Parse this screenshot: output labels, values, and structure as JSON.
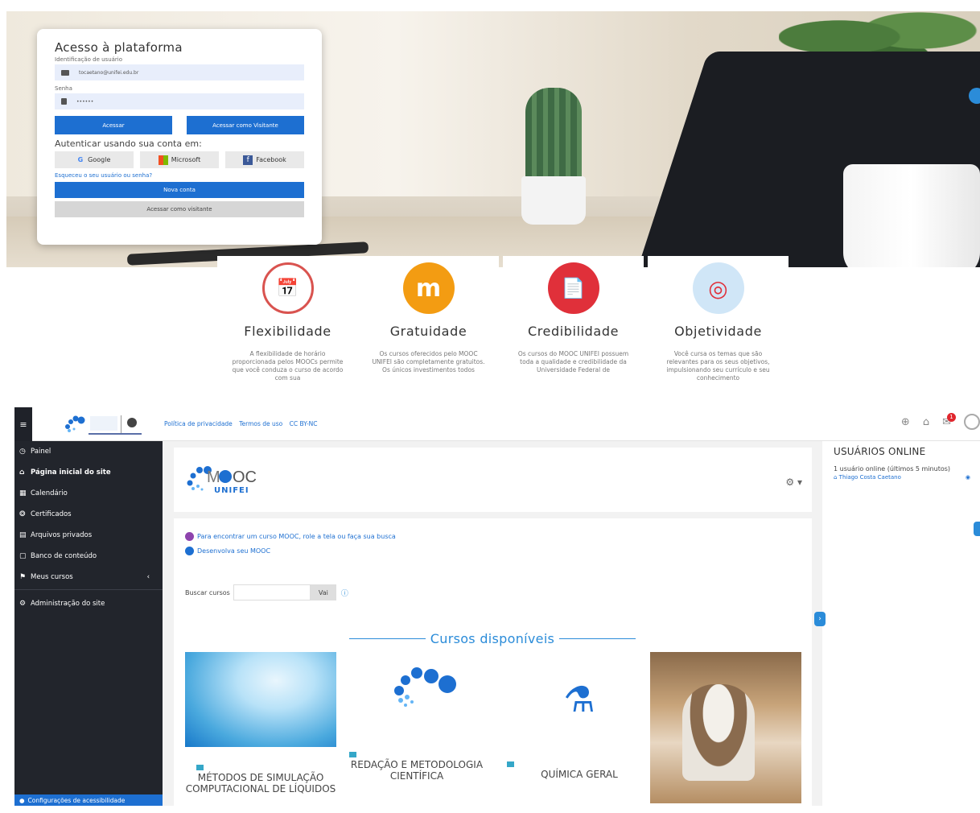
{
  "login": {
    "title": "Acesso à plataforma",
    "user_label": "Identificação de usuário",
    "user_value": "tocaetano@unifei.edu.br",
    "pass_label": "Senha",
    "pass_value": "••••••",
    "login_button": "Acessar",
    "visitor_button": "Acessar como Visitante",
    "auth_label": "Autenticar usando sua conta em:",
    "google": "Google",
    "microsoft": "Microsoft",
    "facebook": "Facebook",
    "forgot": "Esqueceu o seu usuário ou senha?",
    "new_account": "Nova conta",
    "visitor_button2": "Acessar como visitante"
  },
  "features": [
    {
      "title": "Flexibilidade",
      "icon": "calendar-clock-icon",
      "color": "#d9534f",
      "desc": "A flexibilidade de horário proporcionada pelos MOOCs permite que você conduza o curso de acordo com sua"
    },
    {
      "title": "Gratuidade",
      "icon": "moodle-icon",
      "color": "#f39c12",
      "desc": "Os cursos oferecidos pelo MOOC UNIFEI são completamente gratuitos. Os únicos investimentos todos"
    },
    {
      "title": "Credibilidade",
      "icon": "certificate-icon",
      "color": "#e0303a",
      "desc": "Os cursos do MOOC UNIFEI possuem toda a qualidade e credibilidade da Universidade Federal de"
    },
    {
      "title": "Objetividade",
      "icon": "target-icon",
      "color": "#d0e6f7",
      "desc": "Você cursa os temas que são relevantes para os seus objetivos, impulsionando seu currículo e seu conhecimento"
    }
  ],
  "navbar": {
    "links": [
      "Política de privacidade",
      "Termos de uso",
      "CC BY-NC"
    ],
    "notifications_count": "1"
  },
  "sidebar": {
    "items": [
      {
        "label": "Painel",
        "icon": "dashboard-icon"
      },
      {
        "label": "Página inicial do site",
        "icon": "home-icon"
      },
      {
        "label": "Calendário",
        "icon": "calendar-icon"
      },
      {
        "label": "Certificados",
        "icon": "certificate-icon"
      },
      {
        "label": "Arquivos privados",
        "icon": "file-icon"
      },
      {
        "label": "Banco de conteúdo",
        "icon": "folder-icon"
      },
      {
        "label": "Meus cursos",
        "icon": "graduation-cap-icon"
      },
      {
        "label": "Administração do site",
        "icon": "gear-icon"
      }
    ],
    "accessibility": "Configurações de acessibilidade"
  },
  "main": {
    "brand_main": "M",
    "brand_oc": "OC",
    "brand_sub": "UNIFEI",
    "note1": "Para encontrar um curso MOOC, role a tela ou faça sua busca",
    "note2": "Desenvolva seu MOOC",
    "search_label": "Buscar cursos",
    "search_button": "Vai",
    "courses_heading": "Cursos disponíveis",
    "courses": [
      {
        "name": "MÉTODOS DE SIMULAÇÃO COMPUTACIONAL DE LÍQUIDOS"
      },
      {
        "name": "REDAÇÃO E METODOLOGIA CIENTÍFICA"
      },
      {
        "name": "QUÍMICA GERAL"
      },
      {
        "name": ""
      }
    ]
  },
  "online": {
    "title": "USUÁRIOS ONLINE",
    "info": "1 usuário online (últimos 5 minutos)",
    "user": "Thiago Costa Caetano"
  }
}
